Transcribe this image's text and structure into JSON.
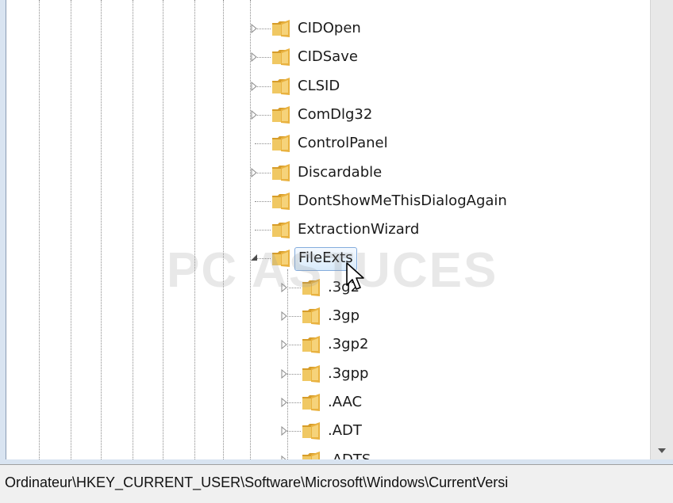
{
  "tree": {
    "items": [
      {
        "label": "CIDOpen",
        "expandable": true,
        "expanded": false,
        "selected": false,
        "level": 0
      },
      {
        "label": "CIDSave",
        "expandable": true,
        "expanded": false,
        "selected": false,
        "level": 0
      },
      {
        "label": "CLSID",
        "expandable": true,
        "expanded": false,
        "selected": false,
        "level": 0
      },
      {
        "label": "ComDlg32",
        "expandable": true,
        "expanded": false,
        "selected": false,
        "level": 0
      },
      {
        "label": "ControlPanel",
        "expandable": false,
        "expanded": false,
        "selected": false,
        "level": 0
      },
      {
        "label": "Discardable",
        "expandable": true,
        "expanded": false,
        "selected": false,
        "level": 0
      },
      {
        "label": "DontShowMeThisDialogAgain",
        "expandable": false,
        "expanded": false,
        "selected": false,
        "level": 0
      },
      {
        "label": "ExtractionWizard",
        "expandable": false,
        "expanded": false,
        "selected": false,
        "level": 0
      },
      {
        "label": "FileExts",
        "expandable": true,
        "expanded": true,
        "selected": true,
        "level": 0
      },
      {
        "label": ".3g2",
        "expandable": true,
        "expanded": false,
        "selected": false,
        "level": 1
      },
      {
        "label": ".3gp",
        "expandable": true,
        "expanded": false,
        "selected": false,
        "level": 1
      },
      {
        "label": ".3gp2",
        "expandable": true,
        "expanded": false,
        "selected": false,
        "level": 1
      },
      {
        "label": ".3gpp",
        "expandable": true,
        "expanded": false,
        "selected": false,
        "level": 1
      },
      {
        "label": ".AAC",
        "expandable": true,
        "expanded": false,
        "selected": false,
        "level": 1
      },
      {
        "label": ".ADT",
        "expandable": true,
        "expanded": false,
        "selected": false,
        "level": 1
      },
      {
        "label": ".ADTS",
        "expandable": true,
        "expanded": false,
        "selected": false,
        "level": 1
      }
    ]
  },
  "statusbar": {
    "path": "Ordinateur\\HKEY_CURRENT_USER\\Software\\Microsoft\\Windows\\CurrentVersi"
  },
  "watermark": {
    "text": "PC ASTUCES"
  },
  "colors": {
    "selection_border": "#84acdd",
    "selection_fill": "#d9ebfb",
    "folder": "#e8b84a",
    "statusbar": "#f0f0f0"
  }
}
